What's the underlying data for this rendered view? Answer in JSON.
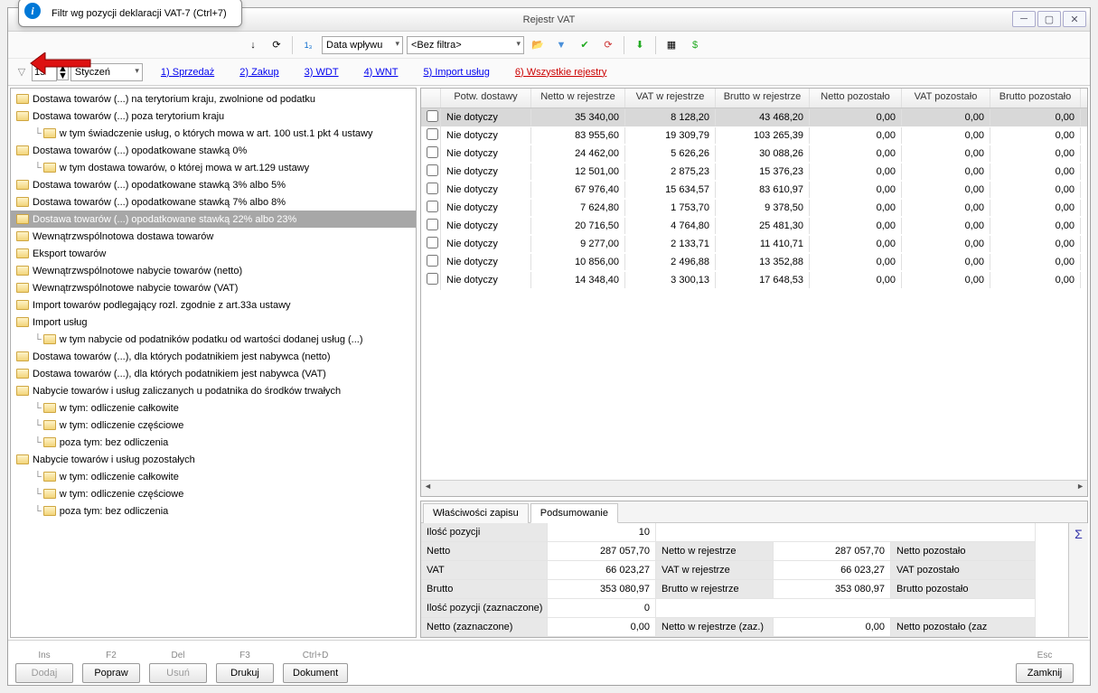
{
  "title": "Rejestr VAT",
  "tooltip": "Filtr wg pozycji deklaracji VAT-7 (Ctrl+7)",
  "toolbar": {
    "combo1": "Data wpływu",
    "combo2": "<Bez filtra>"
  },
  "filter": {
    "year": "15",
    "month": "Styczeń",
    "tabs": [
      {
        "key": "1",
        "label": "1) Sprzedaż",
        "u": "S"
      },
      {
        "key": "2",
        "label": "2) Zakup",
        "u": "Z"
      },
      {
        "key": "3",
        "label": "3) WDT",
        "u": "W"
      },
      {
        "key": "4",
        "label": "4) WNT",
        "u": "W"
      },
      {
        "key": "5",
        "label": "5) Import usług",
        "u": "I"
      },
      {
        "key": "6",
        "label": "6) Wszystkie rejestry",
        "u": "W",
        "active": true
      }
    ]
  },
  "tree": [
    {
      "t": "Dostawa towarów (...) na terytorium kraju, zwolnione od podatku",
      "l": 0
    },
    {
      "t": "Dostawa towarów (...) poza terytorium kraju",
      "l": 0
    },
    {
      "t": "w tym świadczenie usług, o których mowa w art. 100 ust.1 pkt 4 ustawy",
      "l": 1
    },
    {
      "t": "Dostawa towarów (...) opodatkowane stawką 0%",
      "l": 0
    },
    {
      "t": "w tym dostawa towarów, o której mowa w art.129 ustawy",
      "l": 1
    },
    {
      "t": "Dostawa towarów (...) opodatkowane stawką 3% albo 5%",
      "l": 0
    },
    {
      "t": "Dostawa towarów (...) opodatkowane stawką 7% albo 8%",
      "l": 0
    },
    {
      "t": "Dostawa towarów (...) opodatkowane stawką 22% albo 23%",
      "l": 0,
      "sel": true
    },
    {
      "t": "Wewnątrzwspólnotowa dostawa towarów",
      "l": 0
    },
    {
      "t": "Eksport towarów",
      "l": 0
    },
    {
      "t": "Wewnątrzwspólnotowe nabycie towarów (netto)",
      "l": 0
    },
    {
      "t": "Wewnątrzwspólnotowe nabycie towarów (VAT)",
      "l": 0
    },
    {
      "t": "Import towarów podlegający rozl. zgodnie z art.33a ustawy",
      "l": 0
    },
    {
      "t": "Import usług",
      "l": 0
    },
    {
      "t": "w tym nabycie od podatników podatku od wartości dodanej usług (...)",
      "l": 1
    },
    {
      "t": "Dostawa towarów (...), dla których podatnikiem jest nabywca (netto)",
      "l": 0
    },
    {
      "t": "Dostawa towarów (...), dla których podatnikiem jest nabywca (VAT)",
      "l": 0
    },
    {
      "t": "Nabycie towarów i usług zaliczanych u podatnika do środków trwałych",
      "l": 0
    },
    {
      "t": "w tym: odliczenie całkowite",
      "l": 1
    },
    {
      "t": "w tym: odliczenie częściowe",
      "l": 1
    },
    {
      "t": "poza tym: bez odliczenia",
      "l": 1
    },
    {
      "t": "Nabycie towarów i usług pozostałych",
      "l": 0
    },
    {
      "t": "w tym: odliczenie całkowite",
      "l": 1
    },
    {
      "t": "w tym: odliczenie częściowe",
      "l": 1
    },
    {
      "t": "poza tym: bez odliczenia",
      "l": 1
    }
  ],
  "gridHeaders": [
    "Potw. dostawy",
    "Netto w rejestrze",
    "VAT w rejestrze",
    "Brutto w rejestrze",
    "Netto pozostało",
    "VAT pozostało",
    "Brutto pozostało"
  ],
  "rows": [
    {
      "p": "Nie dotyczy",
      "n": "35 340,00",
      "v": "8 128,20",
      "b": "43 468,20",
      "np": "0,00",
      "vp": "0,00",
      "bp": "0,00",
      "sel": true
    },
    {
      "p": "Nie dotyczy",
      "n": "83 955,60",
      "v": "19 309,79",
      "b": "103 265,39",
      "np": "0,00",
      "vp": "0,00",
      "bp": "0,00"
    },
    {
      "p": "Nie dotyczy",
      "n": "24 462,00",
      "v": "5 626,26",
      "b": "30 088,26",
      "np": "0,00",
      "vp": "0,00",
      "bp": "0,00"
    },
    {
      "p": "Nie dotyczy",
      "n": "12 501,00",
      "v": "2 875,23",
      "b": "15 376,23",
      "np": "0,00",
      "vp": "0,00",
      "bp": "0,00"
    },
    {
      "p": "Nie dotyczy",
      "n": "67 976,40",
      "v": "15 634,57",
      "b": "83 610,97",
      "np": "0,00",
      "vp": "0,00",
      "bp": "0,00"
    },
    {
      "p": "Nie dotyczy",
      "n": "7 624,80",
      "v": "1 753,70",
      "b": "9 378,50",
      "np": "0,00",
      "vp": "0,00",
      "bp": "0,00"
    },
    {
      "p": "Nie dotyczy",
      "n": "20 716,50",
      "v": "4 764,80",
      "b": "25 481,30",
      "np": "0,00",
      "vp": "0,00",
      "bp": "0,00"
    },
    {
      "p": "Nie dotyczy",
      "n": "9 277,00",
      "v": "2 133,71",
      "b": "11 410,71",
      "np": "0,00",
      "vp": "0,00",
      "bp": "0,00"
    },
    {
      "p": "Nie dotyczy",
      "n": "10 856,00",
      "v": "2 496,88",
      "b": "13 352,88",
      "np": "0,00",
      "vp": "0,00",
      "bp": "0,00"
    },
    {
      "p": "Nie dotyczy",
      "n": "14 348,40",
      "v": "3 300,13",
      "b": "17 648,53",
      "np": "0,00",
      "vp": "0,00",
      "bp": "0,00"
    }
  ],
  "bottomTabs": {
    "t1": "Właściwości zapisu",
    "t2": "Podsumowanie"
  },
  "summary": {
    "r1": {
      "l": "Ilość pozycji",
      "v": "10"
    },
    "r2": {
      "l": "Netto",
      "v": "287 057,70",
      "l2": "Netto w rejestrze",
      "v2": "287 057,70",
      "l3": "Netto pozostało"
    },
    "r3": {
      "l": "VAT",
      "v": "66 023,27",
      "l2": "VAT w rejestrze",
      "v2": "66 023,27",
      "l3": "VAT pozostało"
    },
    "r4": {
      "l": "Brutto",
      "v": "353 080,97",
      "l2": "Brutto w rejestrze",
      "v2": "353 080,97",
      "l3": "Brutto pozostało"
    },
    "r5": {
      "l": "Ilość pozycji (zaznaczone)",
      "v": "0"
    },
    "r6": {
      "l": "Netto (zaznaczone)",
      "v": "0,00",
      "l2": "Netto w rejestrze (zaz.)",
      "v2": "0,00",
      "l3": "Netto pozostało (zaz"
    }
  },
  "footer": {
    "ins": "Ins",
    "f2": "F2",
    "del": "Del",
    "f3": "F3",
    "ctrld": "Ctrl+D",
    "esc": "Esc",
    "dodaj": "Dodaj",
    "popraw": "Popraw",
    "usun": "Usuń",
    "drukuj": "Drukuj",
    "dokument": "Dokument",
    "zamknij": "Zamknij"
  }
}
